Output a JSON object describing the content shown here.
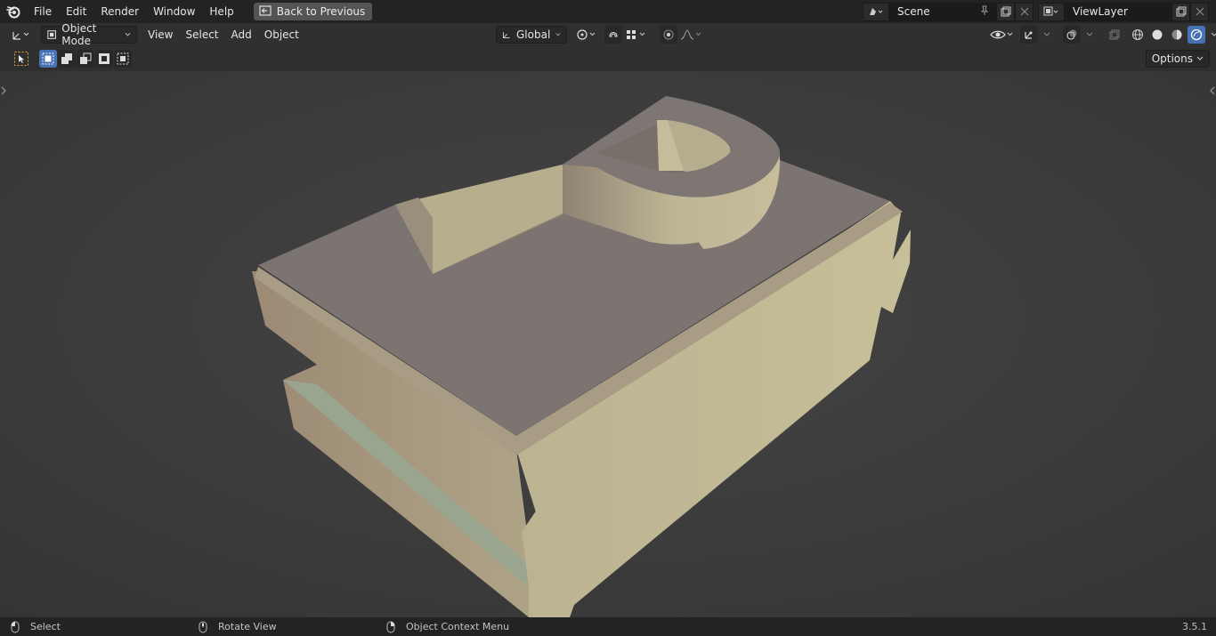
{
  "topbar": {
    "logo": "blender-logo-icon",
    "menus": [
      "File",
      "Edit",
      "Render",
      "Window",
      "Help"
    ],
    "back_button": "Back to Previous",
    "scene": "Scene",
    "view_layer": "ViewLayer"
  },
  "viewport_header": {
    "mode": "Object Mode",
    "menus": [
      "View",
      "Select",
      "Add",
      "Object"
    ],
    "orientation": "Global"
  },
  "toolrow": {
    "options": "Options"
  },
  "statusbar": {
    "select": "Select",
    "rotate": "Rotate View",
    "context": "Object Context Menu",
    "version": "3.5.1"
  },
  "colors": {
    "accent": "#4772b3",
    "model_top": "#7b7470",
    "model_front": "#c0b893",
    "model_side": "#a89a80"
  }
}
